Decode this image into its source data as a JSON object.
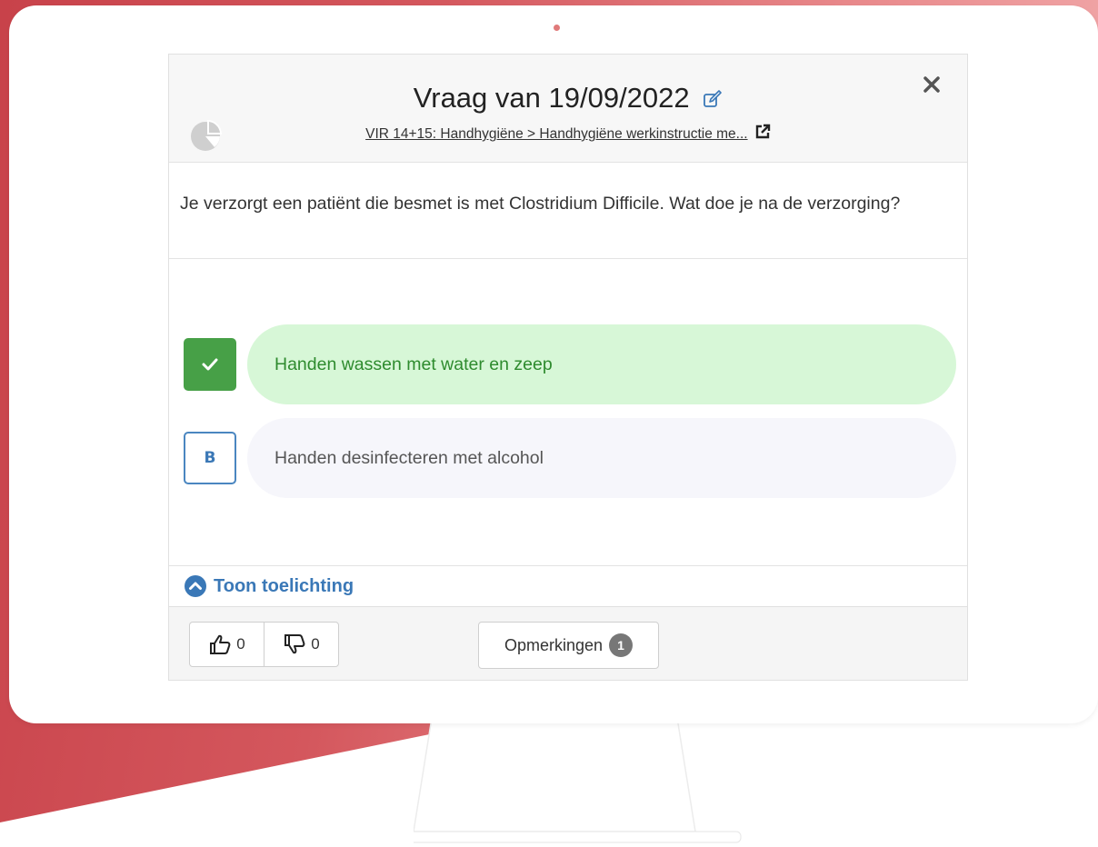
{
  "colors": {
    "accent_blue": "#3a78b7",
    "correct_green": "#47a047",
    "correct_bg": "#d7f7d7",
    "brand_red": "#c8424a"
  },
  "card": {
    "title": "Vraag van 19/09/2022",
    "breadcrumb": "VIR 14+15: Handhygiëne > Handhygiëne werkinstructie me...",
    "question": "Je verzorgt een patiënt die besmet is met Clostridium Difficile. Wat doe je na de verzorging?",
    "answers": [
      {
        "badge": "",
        "text": "Handen wassen met water en zeep",
        "state": "correct",
        "icon": "check-icon"
      },
      {
        "badge": "B",
        "text": "Handen desinfecteren met alcohol",
        "state": "neutral"
      }
    ],
    "toggle_label": "Toon toelichting"
  },
  "footer": {
    "likes": "0",
    "dislikes": "0",
    "remarks_label": "Opmerkingen",
    "remarks_count": "1"
  },
  "icons": [
    "pie-chart-icon",
    "edit-icon",
    "external-link-icon",
    "close-icon",
    "check-icon",
    "chevron-up-circle-icon",
    "thumbs-up-icon",
    "thumbs-down-icon"
  ]
}
